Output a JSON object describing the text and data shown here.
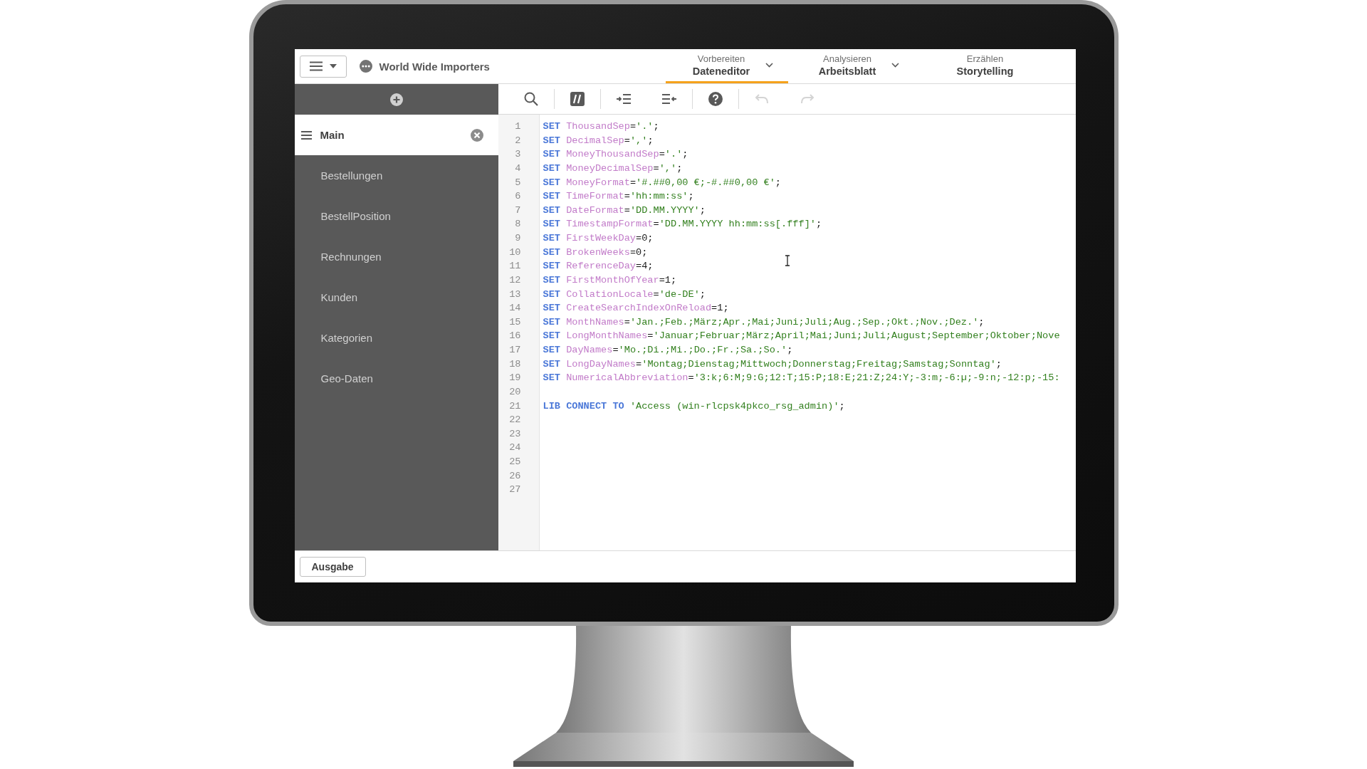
{
  "header": {
    "app_title": "World Wide Importers",
    "tabs": [
      {
        "sublabel": "Vorbereiten",
        "label": "Dateneditor",
        "selected": true,
        "dropdown": true
      },
      {
        "sublabel": "Analysieren",
        "label": "Arbeitsblatt",
        "selected": false,
        "dropdown": true
      },
      {
        "sublabel": "Erzählen",
        "label": "Storytelling",
        "selected": false,
        "dropdown": false
      }
    ]
  },
  "toolbar": [
    {
      "kind": "search",
      "disabled": false
    },
    {
      "kind": "comment",
      "disabled": false
    },
    {
      "kind": "indent",
      "disabled": false
    },
    {
      "kind": "outdent",
      "disabled": false
    },
    {
      "kind": "help",
      "disabled": false
    },
    {
      "kind": "undo",
      "disabled": true
    },
    {
      "kind": "redo",
      "disabled": true
    }
  ],
  "sidebar": {
    "sections": [
      {
        "label": "Main",
        "selected": true
      },
      {
        "label": "Bestellungen",
        "selected": false
      },
      {
        "label": "BestellPosition",
        "selected": false
      },
      {
        "label": "Rechnungen",
        "selected": false
      },
      {
        "label": "Kunden",
        "selected": false
      },
      {
        "label": "Kategorien",
        "selected": false
      },
      {
        "label": "Geo-Daten",
        "selected": false
      }
    ]
  },
  "editor": {
    "lines": [
      {
        "number": "1",
        "tokens": [
          {
            "kind": "keyword",
            "text": "SET "
          },
          {
            "kind": "name",
            "text": "ThousandSep"
          },
          {
            "kind": "plain",
            "text": "="
          },
          {
            "kind": "string",
            "text": "'.'"
          },
          {
            "kind": "plain",
            "text": ";"
          }
        ]
      },
      {
        "number": "2",
        "tokens": [
          {
            "kind": "keyword",
            "text": "SET "
          },
          {
            "kind": "name",
            "text": "DecimalSep"
          },
          {
            "kind": "plain",
            "text": "="
          },
          {
            "kind": "string",
            "text": "','"
          },
          {
            "kind": "plain",
            "text": ";"
          }
        ]
      },
      {
        "number": "3",
        "tokens": [
          {
            "kind": "keyword",
            "text": "SET "
          },
          {
            "kind": "name",
            "text": "MoneyThousandSep"
          },
          {
            "kind": "plain",
            "text": "="
          },
          {
            "kind": "string",
            "text": "'.'"
          },
          {
            "kind": "plain",
            "text": ";"
          }
        ]
      },
      {
        "number": "4",
        "tokens": [
          {
            "kind": "keyword",
            "text": "SET "
          },
          {
            "kind": "name",
            "text": "MoneyDecimalSep"
          },
          {
            "kind": "plain",
            "text": "="
          },
          {
            "kind": "string",
            "text": "','"
          },
          {
            "kind": "plain",
            "text": ";"
          }
        ]
      },
      {
        "number": "5",
        "tokens": [
          {
            "kind": "keyword",
            "text": "SET "
          },
          {
            "kind": "name",
            "text": "MoneyFormat"
          },
          {
            "kind": "plain",
            "text": "="
          },
          {
            "kind": "string",
            "text": "'#.##0,00 €;-#.##0,00 €'"
          },
          {
            "kind": "plain",
            "text": ";"
          }
        ]
      },
      {
        "number": "6",
        "tokens": [
          {
            "kind": "keyword",
            "text": "SET "
          },
          {
            "kind": "name",
            "text": "TimeFormat"
          },
          {
            "kind": "plain",
            "text": "="
          },
          {
            "kind": "string",
            "text": "'hh:mm:ss'"
          },
          {
            "kind": "plain",
            "text": ";"
          }
        ]
      },
      {
        "number": "7",
        "tokens": [
          {
            "kind": "keyword",
            "text": "SET "
          },
          {
            "kind": "name",
            "text": "DateFormat"
          },
          {
            "kind": "plain",
            "text": "="
          },
          {
            "kind": "string",
            "text": "'DD.MM.YYYY'"
          },
          {
            "kind": "plain",
            "text": ";"
          }
        ]
      },
      {
        "number": "8",
        "tokens": [
          {
            "kind": "keyword",
            "text": "SET "
          },
          {
            "kind": "name",
            "text": "TimestampFormat"
          },
          {
            "kind": "plain",
            "text": "="
          },
          {
            "kind": "string",
            "text": "'DD.MM.YYYY hh:mm:ss[.fff]'"
          },
          {
            "kind": "plain",
            "text": ";"
          }
        ]
      },
      {
        "number": "9",
        "tokens": [
          {
            "kind": "keyword",
            "text": "SET "
          },
          {
            "kind": "name",
            "text": "FirstWeekDay"
          },
          {
            "kind": "plain",
            "text": "=0;"
          }
        ]
      },
      {
        "number": "10",
        "tokens": [
          {
            "kind": "keyword",
            "text": "SET "
          },
          {
            "kind": "name",
            "text": "BrokenWeeks"
          },
          {
            "kind": "plain",
            "text": "=0;"
          }
        ]
      },
      {
        "number": "11",
        "tokens": [
          {
            "kind": "keyword",
            "text": "SET "
          },
          {
            "kind": "name",
            "text": "ReferenceDay"
          },
          {
            "kind": "plain",
            "text": "=4;"
          }
        ]
      },
      {
        "number": "12",
        "tokens": [
          {
            "kind": "keyword",
            "text": "SET "
          },
          {
            "kind": "name",
            "text": "FirstMonthOfYear"
          },
          {
            "kind": "plain",
            "text": "=1;"
          }
        ]
      },
      {
        "number": "13",
        "tokens": [
          {
            "kind": "keyword",
            "text": "SET "
          },
          {
            "kind": "name",
            "text": "CollationLocale"
          },
          {
            "kind": "plain",
            "text": "="
          },
          {
            "kind": "string",
            "text": "'de-DE'"
          },
          {
            "kind": "plain",
            "text": ";"
          }
        ]
      },
      {
        "number": "14",
        "tokens": [
          {
            "kind": "keyword",
            "text": "SET "
          },
          {
            "kind": "name",
            "text": "CreateSearchIndexOnReload"
          },
          {
            "kind": "plain",
            "text": "=1;"
          }
        ]
      },
      {
        "number": "15",
        "tokens": [
          {
            "kind": "keyword",
            "text": "SET "
          },
          {
            "kind": "name",
            "text": "MonthNames"
          },
          {
            "kind": "plain",
            "text": "="
          },
          {
            "kind": "string",
            "text": "'Jan.;Feb.;März;Apr.;Mai;Juni;Juli;Aug.;Sep.;Okt.;Nov.;Dez.'"
          },
          {
            "kind": "plain",
            "text": ";"
          }
        ]
      },
      {
        "number": "16",
        "tokens": [
          {
            "kind": "keyword",
            "text": "SET "
          },
          {
            "kind": "name",
            "text": "LongMonthNames"
          },
          {
            "kind": "plain",
            "text": "="
          },
          {
            "kind": "string",
            "text": "'Januar;Februar;März;April;Mai;Juni;Juli;August;September;Oktober;Nove"
          }
        ]
      },
      {
        "number": "17",
        "tokens": [
          {
            "kind": "keyword",
            "text": "SET "
          },
          {
            "kind": "name",
            "text": "DayNames"
          },
          {
            "kind": "plain",
            "text": "="
          },
          {
            "kind": "string",
            "text": "'Mo.;Di.;Mi.;Do.;Fr.;Sa.;So.'"
          },
          {
            "kind": "plain",
            "text": ";"
          }
        ]
      },
      {
        "number": "18",
        "tokens": [
          {
            "kind": "keyword",
            "text": "SET "
          },
          {
            "kind": "name",
            "text": "LongDayNames"
          },
          {
            "kind": "plain",
            "text": "="
          },
          {
            "kind": "string",
            "text": "'Montag;Dienstag;Mittwoch;Donnerstag;Freitag;Samstag;Sonntag'"
          },
          {
            "kind": "plain",
            "text": ";"
          }
        ]
      },
      {
        "number": "19",
        "tokens": [
          {
            "kind": "keyword",
            "text": "SET "
          },
          {
            "kind": "name",
            "text": "NumericalAbbreviation"
          },
          {
            "kind": "plain",
            "text": "="
          },
          {
            "kind": "string",
            "text": "'3:k;6:M;9:G;12:T;15:P;18:E;21:Z;24:Y;-3:m;-6:µ;-9:n;-12:p;-15:"
          }
        ]
      },
      {
        "number": "20"
      },
      {
        "number": "21",
        "tokens": [
          {
            "kind": "keyword",
            "text": "LIB CONNECT TO "
          },
          {
            "kind": "string",
            "text": "'Access (win-rlcpsk4pkco_rsg_admin)'"
          },
          {
            "kind": "plain",
            "text": ";"
          }
        ]
      },
      {
        "number": "22"
      },
      {
        "number": "23"
      },
      {
        "number": "24"
      },
      {
        "number": "25"
      },
      {
        "number": "26"
      },
      {
        "number": "27"
      }
    ]
  },
  "footer": {
    "button": "Ausgabe"
  }
}
